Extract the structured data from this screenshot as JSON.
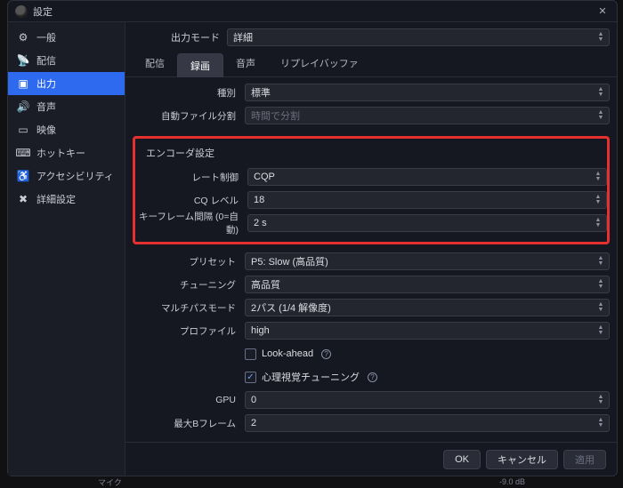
{
  "window": {
    "title": "設定"
  },
  "sidebar": {
    "items": [
      {
        "label": "一般",
        "icon": "⚙"
      },
      {
        "label": "配信",
        "icon": "📡"
      },
      {
        "label": "出力",
        "icon": "▣"
      },
      {
        "label": "音声",
        "icon": "🔊"
      },
      {
        "label": "映像",
        "icon": "▭"
      },
      {
        "label": "ホットキー",
        "icon": "⌨"
      },
      {
        "label": "アクセシビリティ",
        "icon": "♿"
      },
      {
        "label": "詳細設定",
        "icon": "✖"
      }
    ]
  },
  "outputMode": {
    "label": "出力モード",
    "value": "詳細"
  },
  "tabs": [
    "配信",
    "録画",
    "音声",
    "リプレイバッファ"
  ],
  "activeTab": 1,
  "form": {
    "type": {
      "label": "種別",
      "value": "標準"
    },
    "autoSplit": {
      "label": "自動ファイル分割",
      "value": "時間で分割"
    },
    "encoderGroup": {
      "title": "エンコーダ設定",
      "rateControl": {
        "label": "レート制御",
        "value": "CQP"
      },
      "cqLevel": {
        "label": "CQ レベル",
        "value": "18"
      },
      "keyframe": {
        "label": "キーフレーム間隔 (0=自動)",
        "value": "2 s"
      }
    },
    "preset": {
      "label": "プリセット",
      "value": "P5: Slow (高品質)"
    },
    "tuning": {
      "label": "チューニング",
      "value": "高品質"
    },
    "multipass": {
      "label": "マルチパスモード",
      "value": "2パス (1/4 解像度)"
    },
    "profile": {
      "label": "プロファイル",
      "value": "high"
    },
    "lookahead": {
      "label": "Look-ahead",
      "checked": false
    },
    "psycho": {
      "label": "心理視覚チューニング",
      "checked": true
    },
    "gpu": {
      "label": "GPU",
      "value": "0"
    },
    "maxBframes": {
      "label": "最大Bフレーム",
      "value": "2"
    }
  },
  "footer": {
    "ok": "OK",
    "cancel": "キャンセル",
    "apply": "適用"
  },
  "statusbar": {
    "mic": "マイク",
    "db": "-9.0 dB"
  }
}
